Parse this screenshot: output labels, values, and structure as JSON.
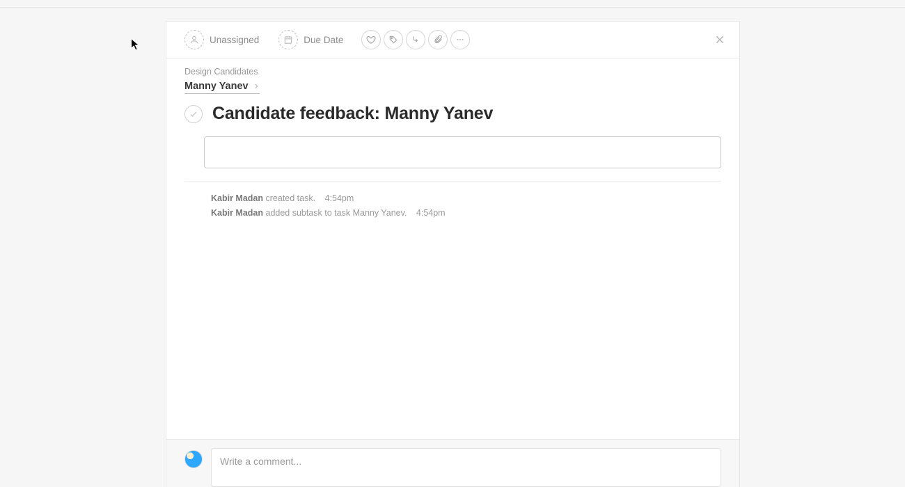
{
  "toolbar": {
    "assignee_label": "Unassigned",
    "due_label": "Due Date"
  },
  "breadcrumb": {
    "project": "Design Candidates",
    "parent_task": "Manny Yanev"
  },
  "task": {
    "title": "Candidate feedback: Manny Yanev",
    "description": ""
  },
  "activity": [
    {
      "actor": "Kabir Madan",
      "action": "created task.",
      "time": "4:54pm"
    },
    {
      "actor": "Kabir Madan",
      "action": "added subtask to task Manny Yanev.",
      "time": "4:54pm"
    }
  ],
  "composer": {
    "placeholder": "Write a comment..."
  }
}
